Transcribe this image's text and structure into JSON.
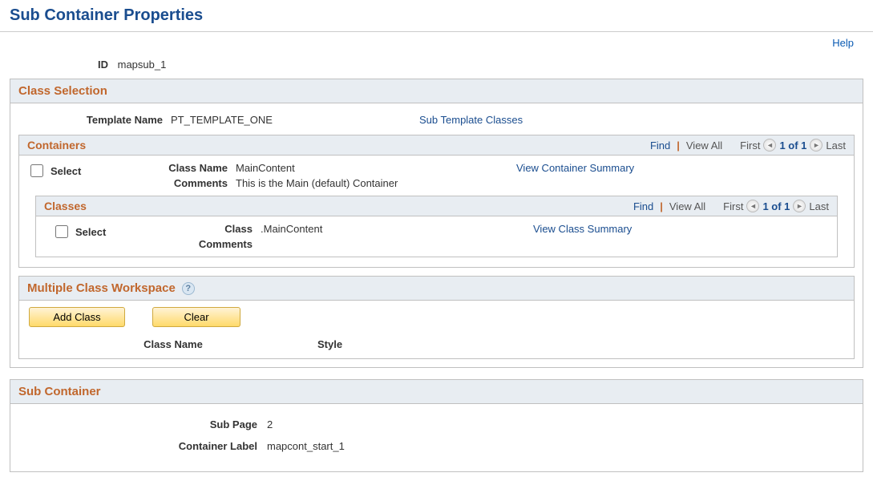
{
  "pageTitle": "Sub Container Properties",
  "helpLabel": "Help",
  "id": {
    "label": "ID",
    "value": "mapsub_1"
  },
  "classSelection": {
    "title": "Class Selection",
    "templateName": {
      "label": "Template Name",
      "value": "PT_TEMPLATE_ONE"
    },
    "subTemplateClassesLink": "Sub Template Classes"
  },
  "containers": {
    "title": "Containers",
    "toolbar": {
      "find": "Find",
      "viewAll": "View All",
      "first": "First",
      "counter": "1 of 1",
      "last": "Last"
    },
    "selectLabel": "Select",
    "classNameLabel": "Class Name",
    "classNameValue": "MainContent",
    "commentsLabel": "Comments",
    "commentsValue": "This is the Main (default) Container",
    "viewSummaryLink": "View Container Summary"
  },
  "classes": {
    "title": "Classes",
    "toolbar": {
      "find": "Find",
      "viewAll": "View All",
      "first": "First",
      "counter": "1 of 1",
      "last": "Last"
    },
    "selectLabel": "Select",
    "classLabel": "Class",
    "classValue": ".MainContent",
    "commentsLabel": "Comments",
    "viewSummaryLink": "View Class Summary"
  },
  "mcw": {
    "title": "Multiple Class Workspace",
    "addClassBtn": "Add Class",
    "clearBtn": "Clear",
    "colClassName": "Class Name",
    "colStyle": "Style"
  },
  "subContainer": {
    "title": "Sub Container",
    "subPageLabel": "Sub Page",
    "subPageValue": "2",
    "containerLabelLabel": "Container Label",
    "containerLabelValue": "mapcont_start_1"
  }
}
